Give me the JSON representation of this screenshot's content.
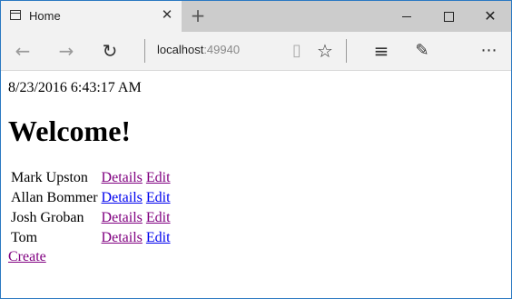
{
  "tab": {
    "title": "Home",
    "close_icon": "close-icon"
  },
  "window_controls": {
    "minimize": "minimize",
    "maximize": "maximize",
    "close": "✕"
  },
  "toolbar": {
    "address_host": "localhost",
    "address_port": ":49940"
  },
  "page": {
    "timestamp": "8/23/2016 6:43:17 AM",
    "heading": "Welcome!",
    "users": [
      {
        "name": "Mark Upston",
        "details": "Details",
        "edit": "Edit"
      },
      {
        "name": "Allan Bommer",
        "details": "Details",
        "edit": "Edit"
      },
      {
        "name": "Josh Groban",
        "details": "Details",
        "edit": "Edit"
      },
      {
        "name": "Tom",
        "details": "Details",
        "edit": "Edit"
      }
    ],
    "create_label": "Create"
  },
  "colors": {
    "visited_link": "#800080",
    "link": "#0000ee",
    "window_border": "#2b79c2"
  }
}
